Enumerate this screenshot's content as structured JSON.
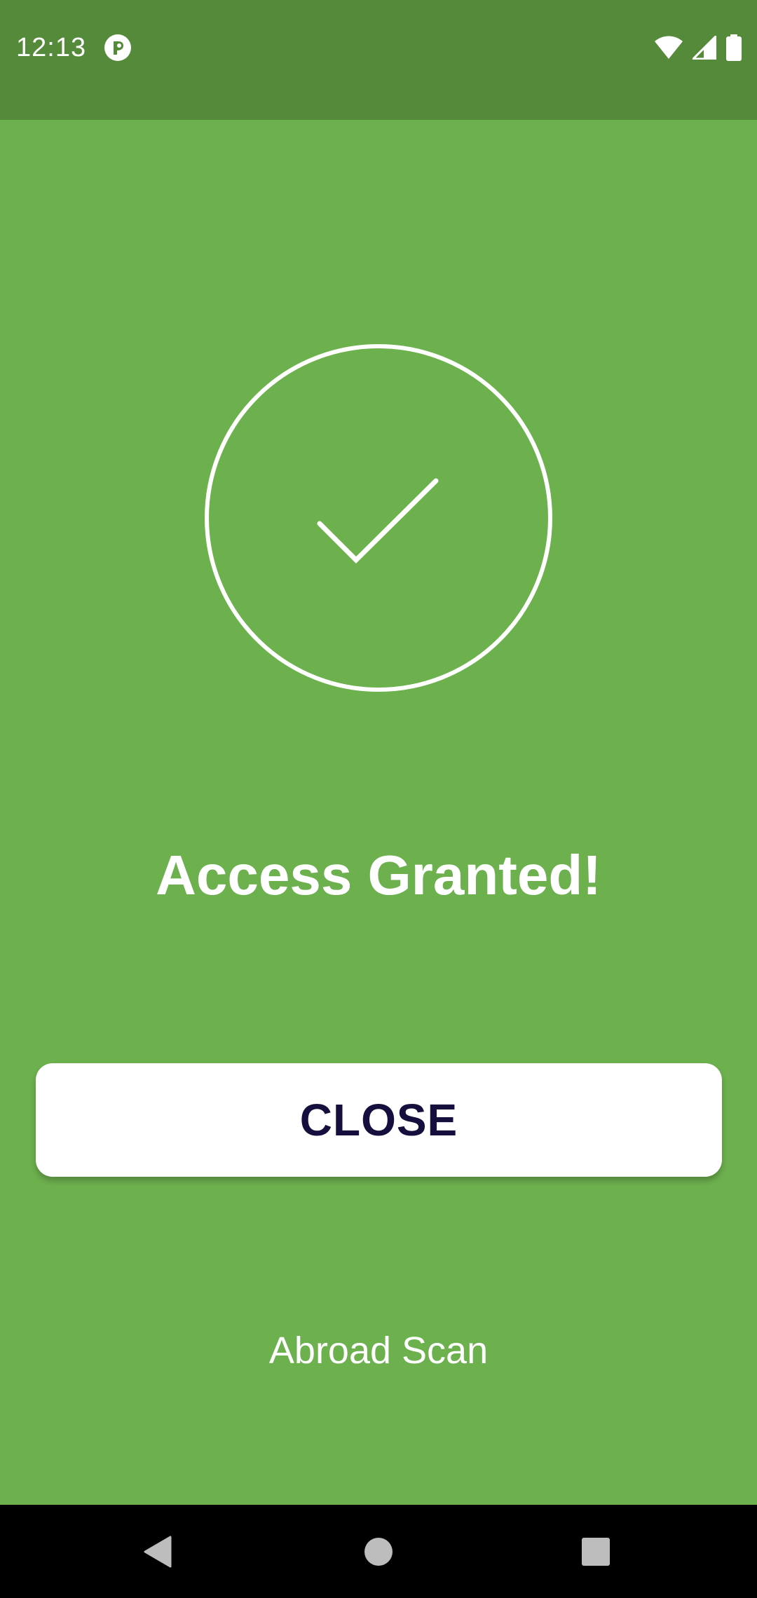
{
  "status_bar": {
    "time": "12:13",
    "app_icon": "circle-p-icon",
    "wifi_icon": "wifi-icon",
    "signal_icon": "cell-signal-icon",
    "battery_icon": "battery-icon"
  },
  "result": {
    "icon": "check-circle-icon",
    "title": "Access Granted!"
  },
  "actions": {
    "close_label": "CLOSE"
  },
  "footer": {
    "label": "Abroad Scan"
  },
  "nav_bar": {
    "back_icon": "back-triangle-icon",
    "home_icon": "home-circle-icon",
    "recents_icon": "recents-square-icon"
  },
  "colors": {
    "status_bar": "#548A3A",
    "background": "#6DB04E",
    "button_text": "#140F3C",
    "nav_bar": "#000000"
  }
}
